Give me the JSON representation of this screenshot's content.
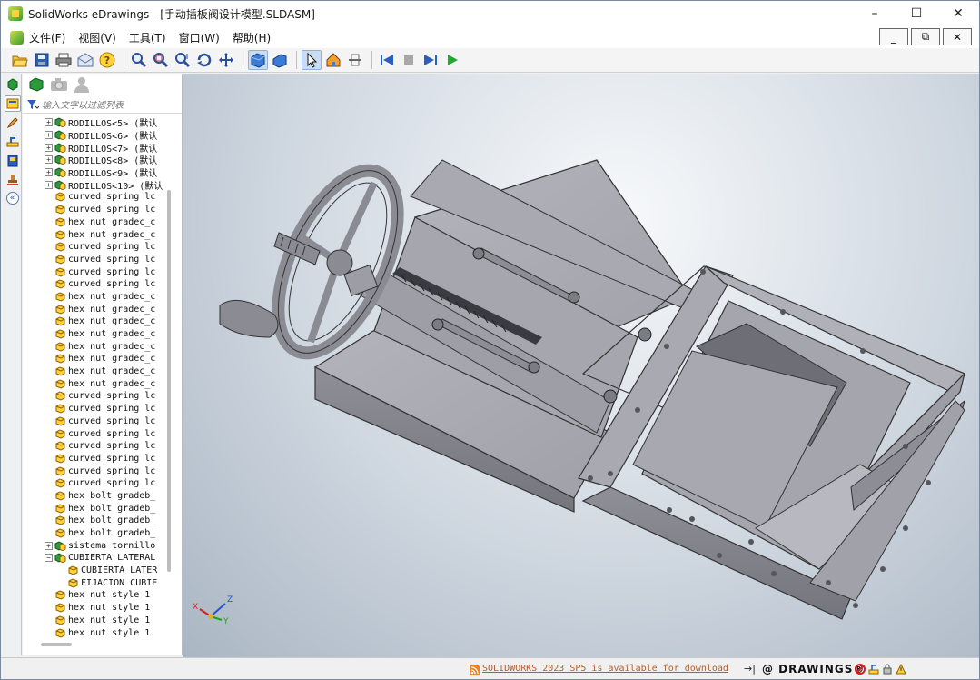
{
  "window": {
    "title": "SolidWorks eDrawings - [手动插板阀设计模型.SLDASM]",
    "minimize": "–",
    "maximize": "☐",
    "close": "✕"
  },
  "menubar": {
    "items": [
      {
        "label": "文件(F)"
      },
      {
        "label": "视图(V)"
      },
      {
        "label": "工具(T)"
      },
      {
        "label": "窗口(W)"
      },
      {
        "label": "帮助(H)"
      }
    ],
    "mdi_min": "_",
    "mdi_restore": "⧉",
    "mdi_close": "✕"
  },
  "toolbar": {
    "buttons": [
      "open-icon",
      "save-icon",
      "print-icon",
      "send-icon",
      "help-icon",
      "zoom-fit-icon",
      "zoom-area-icon",
      "zoom-icon",
      "rotate-icon",
      "pan-icon",
      "shaded-icon",
      "perspective-icon",
      "select-icon",
      "home-icon",
      "section-icon",
      "first-frame-icon",
      "stop-icon",
      "next-frame-icon",
      "play-icon"
    ]
  },
  "panel": {
    "filter_placeholder": "输入文字以过滤列表",
    "tree": [
      {
        "label": "RODILLOS<5> (默认",
        "expandable": true,
        "type": "assembly"
      },
      {
        "label": "RODILLOS<6> (默认",
        "expandable": true,
        "type": "assembly"
      },
      {
        "label": "RODILLOS<7> (默认",
        "expandable": true,
        "type": "assembly"
      },
      {
        "label": "RODILLOS<8> (默认",
        "expandable": true,
        "type": "assembly"
      },
      {
        "label": "RODILLOS<9> (默认",
        "expandable": true,
        "type": "assembly"
      },
      {
        "label": "RODILLOS<10> (默认",
        "expandable": true,
        "type": "assembly"
      },
      {
        "label": "curved spring lc",
        "expandable": false,
        "type": "part"
      },
      {
        "label": "curved spring lc",
        "expandable": false,
        "type": "part"
      },
      {
        "label": "hex nut gradec_c",
        "expandable": false,
        "type": "part"
      },
      {
        "label": "hex nut gradec_c",
        "expandable": false,
        "type": "part"
      },
      {
        "label": "curved spring lc",
        "expandable": false,
        "type": "part"
      },
      {
        "label": "curved spring lc",
        "expandable": false,
        "type": "part"
      },
      {
        "label": "curved spring lc",
        "expandable": false,
        "type": "part"
      },
      {
        "label": "curved spring lc",
        "expandable": false,
        "type": "part"
      },
      {
        "label": "hex nut gradec_c",
        "expandable": false,
        "type": "part"
      },
      {
        "label": "hex nut gradec_c",
        "expandable": false,
        "type": "part"
      },
      {
        "label": "hex nut gradec_c",
        "expandable": false,
        "type": "part"
      },
      {
        "label": "hex nut gradec_c",
        "expandable": false,
        "type": "part"
      },
      {
        "label": "hex nut gradec_c",
        "expandable": false,
        "type": "part"
      },
      {
        "label": "hex nut gradec_c",
        "expandable": false,
        "type": "part"
      },
      {
        "label": "hex nut gradec_c",
        "expandable": false,
        "type": "part"
      },
      {
        "label": "hex nut gradec_c",
        "expandable": false,
        "type": "part"
      },
      {
        "label": "curved spring lc",
        "expandable": false,
        "type": "part"
      },
      {
        "label": "curved spring lc",
        "expandable": false,
        "type": "part"
      },
      {
        "label": "curved spring lc",
        "expandable": false,
        "type": "part"
      },
      {
        "label": "curved spring lc",
        "expandable": false,
        "type": "part"
      },
      {
        "label": "curved spring lc",
        "expandable": false,
        "type": "part"
      },
      {
        "label": "curved spring lc",
        "expandable": false,
        "type": "part"
      },
      {
        "label": "curved spring lc",
        "expandable": false,
        "type": "part"
      },
      {
        "label": "curved spring lc",
        "expandable": false,
        "type": "part"
      },
      {
        "label": "hex bolt gradeb_",
        "expandable": false,
        "type": "part"
      },
      {
        "label": "hex bolt gradeb_",
        "expandable": false,
        "type": "part"
      },
      {
        "label": "hex bolt gradeb_",
        "expandable": false,
        "type": "part"
      },
      {
        "label": "hex bolt gradeb_",
        "expandable": false,
        "type": "part"
      },
      {
        "label": "sistema tornillo",
        "expandable": true,
        "type": "assembly"
      },
      {
        "label": "CUBIERTA LATERAL",
        "expandable": true,
        "expanded": true,
        "type": "assembly"
      },
      {
        "label": "CUBIERTA LATER",
        "expandable": false,
        "type": "part",
        "child": true
      },
      {
        "label": "FIJACION CUBIE",
        "expandable": false,
        "type": "part",
        "child": true
      },
      {
        "label": "hex nut style 1",
        "expandable": false,
        "type": "part"
      },
      {
        "label": "hex nut style 1",
        "expandable": false,
        "type": "part"
      },
      {
        "label": "hex nut style 1",
        "expandable": false,
        "type": "part"
      },
      {
        "label": "hex nut style 1",
        "expandable": false,
        "type": "part"
      }
    ]
  },
  "viewport": {
    "triad": {
      "x": "X",
      "y": "Y",
      "z": "Z"
    }
  },
  "statusbar": {
    "update_notice": "SOLIDWORKS 2023 SP5 is available for download",
    "separator": "→|",
    "brand": "@ DRAWINGS®"
  },
  "colors": {
    "model_gray": "#9a9ba2",
    "model_dark": "#6e6f76",
    "viewport_top": "#f7f9fb",
    "viewport_bottom": "#aab6c3"
  }
}
